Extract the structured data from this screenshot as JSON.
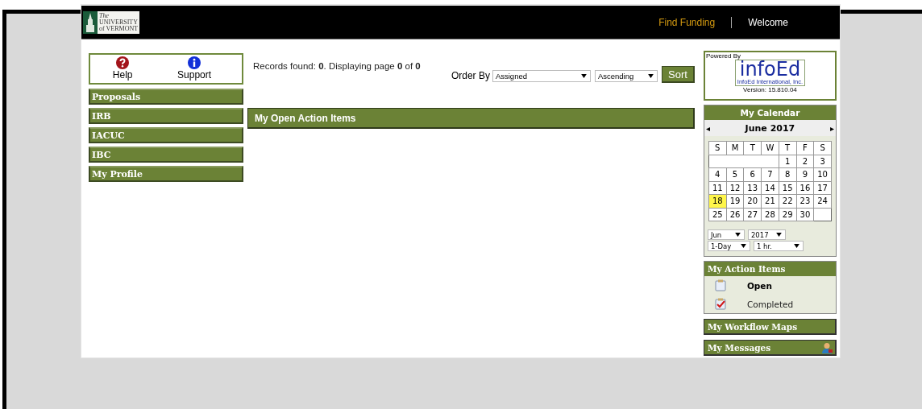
{
  "header": {
    "logo": {
      "line_1": "The",
      "line_2": "UNIVERSITY",
      "line_3": "of VERMONT"
    },
    "links": [
      {
        "label": "Find Funding",
        "kind": "link"
      },
      {
        "label": "Welcome",
        "kind": "text"
      }
    ]
  },
  "quick_links": [
    {
      "label": "Help",
      "kind": "help"
    },
    {
      "label": "Support",
      "kind": "info"
    }
  ],
  "sidebar": {
    "items": [
      {
        "label": "Proposals"
      },
      {
        "label": "IRB"
      },
      {
        "label": "IACUC"
      },
      {
        "label": "IBC"
      },
      {
        "label": "My Profile"
      }
    ]
  },
  "records": {
    "text": "Records found: **0**. Displaying page **0** of **0**"
  },
  "sort": {
    "label": "Order By",
    "field": "Assigned",
    "direction": "Ascending",
    "button": "Sort"
  },
  "panel": {
    "title": "My Open Action Items"
  },
  "powered_by": {
    "label": "Powered By",
    "logo": "infoEd",
    "company": "InfoEd International, Inc.",
    "version": "Version: 15.810.04"
  },
  "calendar": {
    "title": "My Calendar",
    "prev": "◂",
    "month": "June 2017",
    "next": "▸",
    "weekdays": [
      "S",
      "M",
      "T",
      "W",
      "T",
      "F",
      "S"
    ],
    "weeks": [
      [
        {
          "kind": "empty"
        },
        {
          "kind": "empty"
        },
        {
          "kind": "empty"
        },
        {
          "kind": "empty"
        },
        {
          "day": "1",
          "selected": false
        },
        {
          "day": "2",
          "selected": false
        },
        {
          "day": "3",
          "selected": false
        }
      ],
      [
        {
          "day": "4",
          "selected": false
        },
        {
          "day": "5",
          "selected": false
        },
        {
          "day": "6",
          "selected": false
        },
        {
          "day": "7",
          "selected": false
        },
        {
          "day": "8",
          "selected": false
        },
        {
          "day": "9",
          "selected": false
        },
        {
          "day": "10",
          "selected": false
        }
      ],
      [
        {
          "day": "11",
          "selected": false
        },
        {
          "day": "12",
          "selected": false
        },
        {
          "day": "13",
          "selected": false
        },
        {
          "day": "14",
          "selected": false
        },
        {
          "day": "15",
          "selected": false
        },
        {
          "day": "16",
          "selected": false
        },
        {
          "day": "17",
          "selected": false
        }
      ],
      [
        {
          "day": "18",
          "selected": true
        },
        {
          "day": "19",
          "selected": false
        },
        {
          "day": "20",
          "selected": false
        },
        {
          "day": "21",
          "selected": false
        },
        {
          "day": "22",
          "selected": false
        },
        {
          "day": "23",
          "selected": false
        },
        {
          "day": "24",
          "selected": false
        }
      ],
      [
        {
          "day": "25",
          "selected": false
        },
        {
          "day": "26",
          "selected": false
        },
        {
          "day": "27",
          "selected": false
        },
        {
          "day": "28",
          "selected": false
        },
        {
          "day": "29",
          "selected": false
        },
        {
          "day": "30",
          "selected": false
        },
        {
          "kind": "empty"
        }
      ]
    ],
    "selects": [
      [
        "Jun",
        "2017"
      ],
      [
        "1-Day",
        "1 hr."
      ]
    ]
  },
  "action_items": {
    "title": "My Action Items",
    "items": [
      {
        "label": "Open",
        "kind": "open",
        "selected": true
      },
      {
        "label": "Completed",
        "kind": "completed",
        "selected": false
      }
    ]
  },
  "widgets": [
    {
      "title": "My Workflow Maps",
      "icon": false
    },
    {
      "title": "My Messages",
      "icon": true
    }
  ]
}
